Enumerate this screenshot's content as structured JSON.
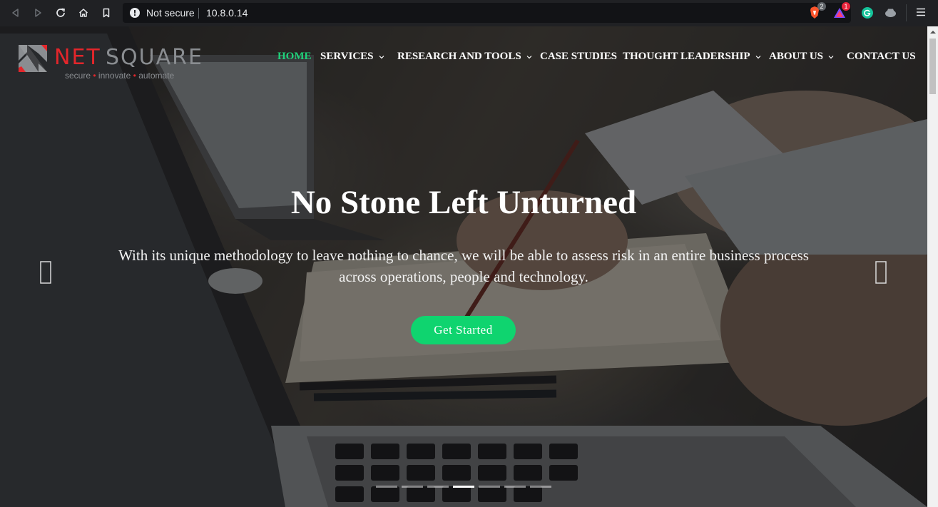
{
  "browser": {
    "security_label": "Not secure",
    "url": "10.8.0.14",
    "shield_badge": "2",
    "rewards_badge": "1",
    "icons": [
      "back-icon",
      "forward-icon",
      "reload-icon",
      "home-icon",
      "bookmark-icon",
      "info-icon",
      "brave-shield-icon",
      "brave-rewards-icon",
      "grammarly-icon",
      "incognito-extension-icon",
      "menu-icon"
    ]
  },
  "logo": {
    "part1": "NET",
    "part2": "SQUARE",
    "tagline": [
      "secure",
      "innovate",
      "automate"
    ],
    "colors": {
      "accent": "#e3262b",
      "gray": "#8a8d91"
    }
  },
  "nav": {
    "items": [
      {
        "label": "HOME",
        "active": true,
        "dropdown": false
      },
      {
        "label": "SERVICES",
        "active": false,
        "dropdown": true
      },
      {
        "label": "RESEARCH AND TOOLS",
        "active": false,
        "dropdown": true
      },
      {
        "label": "CASE STUDIES",
        "active": false,
        "dropdown": false
      },
      {
        "label": "THOUGHT LEADERSHIP",
        "active": false,
        "dropdown": true
      },
      {
        "label": "ABOUT US",
        "active": false,
        "dropdown": true
      },
      {
        "label": "CONTACT US",
        "active": false,
        "dropdown": false
      }
    ],
    "active_color": "#1fd37a"
  },
  "hero": {
    "title": "No Stone Left Unturned",
    "text": "With its unique methodology to leave nothing to chance, we will be able to assess risk in an entire business process across operations, people and technology.",
    "cta_label": "Get Started",
    "cta_color": "#0fd46f",
    "slide_count": 7,
    "active_slide": 4
  }
}
